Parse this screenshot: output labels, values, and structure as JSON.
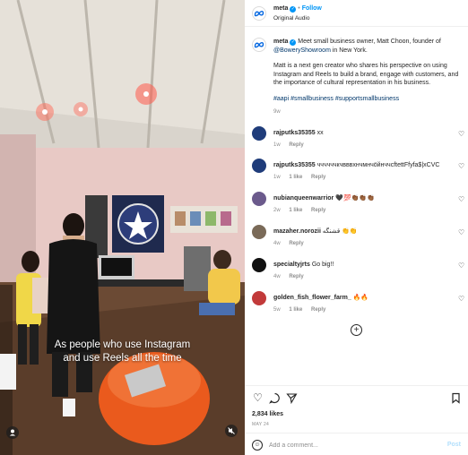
{
  "colors": {
    "accent": "#0095f6",
    "link": "#00376b",
    "muted": "#8e8e8e",
    "meta_blue": "#0668e1"
  },
  "video": {
    "caption_lines": [
      "As people who use Instagram",
      "and use Reels all the time"
    ],
    "profile_icon": "user-icon",
    "mute_icon": "speaker-muted-icon"
  },
  "header": {
    "username": "meta",
    "follow_label": "Follow",
    "audio_label": "Original Audio",
    "separator": "•"
  },
  "post": {
    "username": "meta",
    "caption_intro": "Meet small business owner, Matt Choon, founder of",
    "mention": "@BoweryShowroom",
    "caption_outro": "in New York.",
    "paragraph": "Matt is a next gen creator who shares his perspective on using Instagram and Reels to build a brand, engage with customers, and the importance of cultural representation in his business.",
    "hashtags": "#aapi #smallbusiness #supportsmallbusiness",
    "age": "9w"
  },
  "comments": [
    {
      "username": "rajputks35355",
      "text": "xx",
      "age": "1w",
      "likes": "",
      "reply": "Reply"
    },
    {
      "username": "rajputks35355",
      "text": "ччччччкчвввхнчмнчöйнччcftettFfyfa$|xCVC",
      "age": "1w",
      "likes": "1 like",
      "reply": "Reply"
    },
    {
      "username": "nubianqueenwarrior",
      "text": "🖤💯👏🏾👏🏾👏🏾",
      "age": "2w",
      "likes": "1 like",
      "reply": "Reply"
    },
    {
      "username": "mazaher.norozii",
      "text": "قشنگه 👏👏",
      "age": "4w",
      "likes": "",
      "reply": "Reply"
    },
    {
      "username": "specialtyjrts",
      "text": "Go big!!",
      "age": "4w",
      "likes": "",
      "reply": "Reply"
    },
    {
      "username": "golden_fish_flower_farm_",
      "text": "🔥🔥",
      "age": "5w",
      "likes": "1 like",
      "reply": "Reply"
    }
  ],
  "actions": {
    "like_icon": "heart-icon",
    "comment_icon": "comment-icon",
    "share_icon": "send-icon",
    "save_icon": "bookmark-icon",
    "likes_count": "2,834 likes",
    "date": "MAY 24"
  },
  "add_comment": {
    "placeholder": "Add a comment...",
    "post_label": "Post"
  }
}
